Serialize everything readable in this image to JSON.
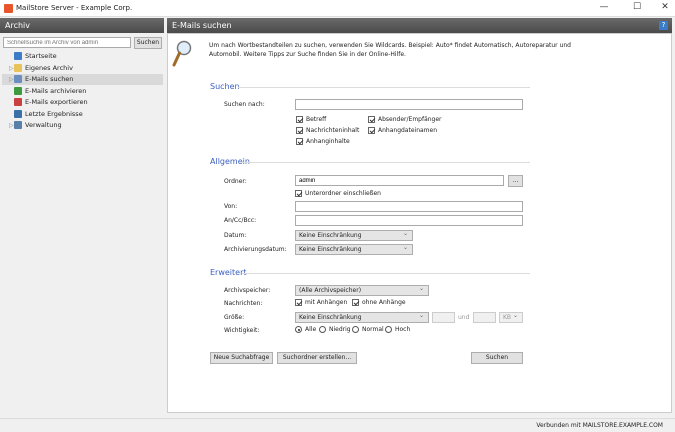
{
  "window": {
    "title": "MailStore Server - Example Corp.",
    "minimize": "—",
    "maximize": "☐",
    "close": "✕"
  },
  "sidebar": {
    "header": "Archiv",
    "search_placeholder": "Schnellsuche im Archiv von admin",
    "search_button": "Suchen",
    "items": [
      {
        "label": "Startseite",
        "expandable": false,
        "color": "#3b7bc8"
      },
      {
        "label": "Eigenes Archiv",
        "expandable": true,
        "color": "#e8c25a"
      },
      {
        "label": "E-Mails suchen",
        "expandable": true,
        "selected": true,
        "color": "#6a8fbf"
      },
      {
        "label": "E-Mails archivieren",
        "expandable": false,
        "color": "#3e9a3e"
      },
      {
        "label": "E-Mails exportieren",
        "expandable": false,
        "color": "#c84040"
      },
      {
        "label": "Letzte Ergebnisse",
        "expandable": false,
        "color": "#3b6fa8"
      },
      {
        "label": "Verwaltung",
        "expandable": true,
        "color": "#5a7fa8"
      }
    ]
  },
  "main": {
    "header": "E-Mails suchen",
    "help": "?",
    "intro_line1": "Um nach Wortbestandteilen zu suchen, verwenden Sie Wildcards. Beispiel: Auto* findet Automatisch, Autoreparatur und",
    "intro_line2": "Automobil. Weitere Tipps zur Suche finden Sie in der Online-Hilfe.",
    "suchen": {
      "title": "Suchen",
      "search_for_label": "Suchen nach:",
      "search_for_value": "",
      "options": [
        {
          "label": "Betreff",
          "checked": true
        },
        {
          "label": "Absender/Empfänger",
          "checked": true
        },
        {
          "label": "Nachrichteninhalt",
          "checked": true
        },
        {
          "label": "Anhangdateinamen",
          "checked": true
        },
        {
          "label": "Anhanginhalte",
          "checked": true
        }
      ]
    },
    "allgemein": {
      "title": "Allgemein",
      "folder_label": "Ordner:",
      "folder_value": "admin",
      "browse": "...",
      "subfolders_label": "Unterordner einschließen",
      "subfolders_checked": true,
      "from_label": "Von:",
      "from_value": "",
      "to_label": "An/Cc/Bcc:",
      "to_value": "",
      "date_label": "Datum:",
      "date_value": "Keine Einschränkung",
      "archdate_label": "Archivierungsdatum:",
      "archdate_value": "Keine Einschränkung"
    },
    "erweitert": {
      "title": "Erweitert",
      "store_label": "Archivspeicher:",
      "store_value": "(Alle Archivspeicher)",
      "messages_label": "Nachrichten:",
      "with_att": "mit Anhängen",
      "with_att_checked": true,
      "without_att": "ohne Anhänge",
      "without_att_checked": true,
      "size_label": "Größe:",
      "size_value": "Keine Einschränkung",
      "size_and": "und",
      "size_unit": "KB",
      "importance_label": "Wichtigkeit:",
      "importance_options": [
        "Alle",
        "Niedrig",
        "Normal",
        "Hoch"
      ],
      "importance_selected": "Alle"
    },
    "buttons": {
      "new_query": "Neue Suchabfrage",
      "create_folder": "Suchordner erstellen...",
      "search": "Suchen"
    }
  },
  "status": {
    "text": "Verbunden mit MAILSTORE.EXAMPLE.COM"
  }
}
